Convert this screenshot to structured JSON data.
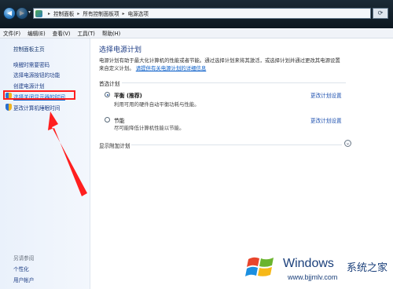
{
  "address_bar": {
    "segments": [
      "控制面板",
      "所有控制面板项",
      "电源选项"
    ]
  },
  "menu": [
    "文件(F)",
    "编辑(E)",
    "查看(V)",
    "工具(T)",
    "帮助(H)"
  ],
  "sidebar": {
    "home": "控制面板主页",
    "links": [
      "唤醒时需要密码",
      "选择电源按钮的功能",
      "创建电源计划",
      "选择关闭显示器的时间",
      "更改计算机睡眠时间"
    ],
    "see_also": "另请参阅",
    "bottom_links": [
      "个性化",
      "用户帐户"
    ]
  },
  "main": {
    "title": "选择电源计划",
    "desc_line1": "电源计划有助于最大化计算机的性能或者节能。通过选择计划来将其激活，或选择计划并通过更改其电源设置",
    "desc_line2": "来自定义计划。",
    "desc_link": "请提供有关电源计划的详细信息",
    "section": "首选计划",
    "plans": [
      {
        "name": "平衡 (推荐)",
        "desc": "利用可用的硬件自动平衡功耗与性能。",
        "selected": true,
        "link": "更改计划设置"
      },
      {
        "name": "节能",
        "desc": "尽可能降低计算机性能以节能。",
        "selected": false,
        "link": "更改计划设置"
      }
    ],
    "extra": "显示附加计划"
  },
  "watermark": {
    "brand": "Windows",
    "sub": "系统之家",
    "url": "www.bjjmlv.com"
  },
  "colors": {
    "accent_link": "#1f52b0",
    "annotation_red": "#ff1f1f"
  }
}
